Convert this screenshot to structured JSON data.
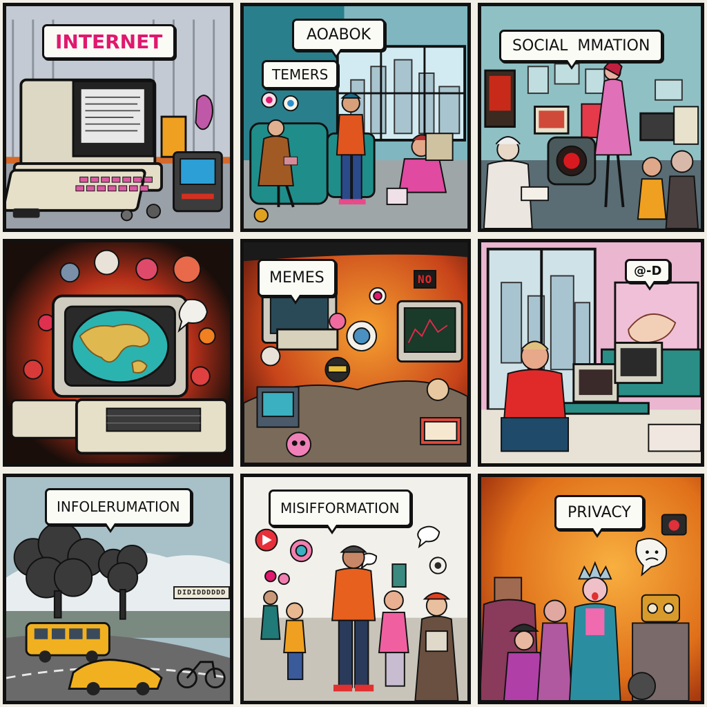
{
  "panels": [
    {
      "id": "p1",
      "caption": "INTERNET",
      "caption_color": "#e0186e"
    },
    {
      "id": "p2",
      "caption": "AOABOK",
      "caption2": "TEMERS"
    },
    {
      "id": "p3",
      "caption": "SOCIAL  MMATION"
    },
    {
      "id": "p4",
      "caption": ""
    },
    {
      "id": "p5",
      "caption": "MEMES",
      "sign": "NO"
    },
    {
      "id": "p6",
      "caption": "@-D"
    },
    {
      "id": "p7",
      "caption": "INFOLERUMATION",
      "sign": "DIDIDDDDDD"
    },
    {
      "id": "p8",
      "caption": "MISIFFORMATION"
    },
    {
      "id": "p9",
      "caption": "PRIVACY"
    }
  ],
  "colors": {
    "ink": "#111111",
    "pink": "#e0186e",
    "teal": "#1f8e8a",
    "orange": "#f28a1c",
    "cream": "#e9e2c8"
  },
  "icons": [
    "computer-icon",
    "globe-icon",
    "play-icon",
    "speech-icon",
    "camera-icon"
  ]
}
